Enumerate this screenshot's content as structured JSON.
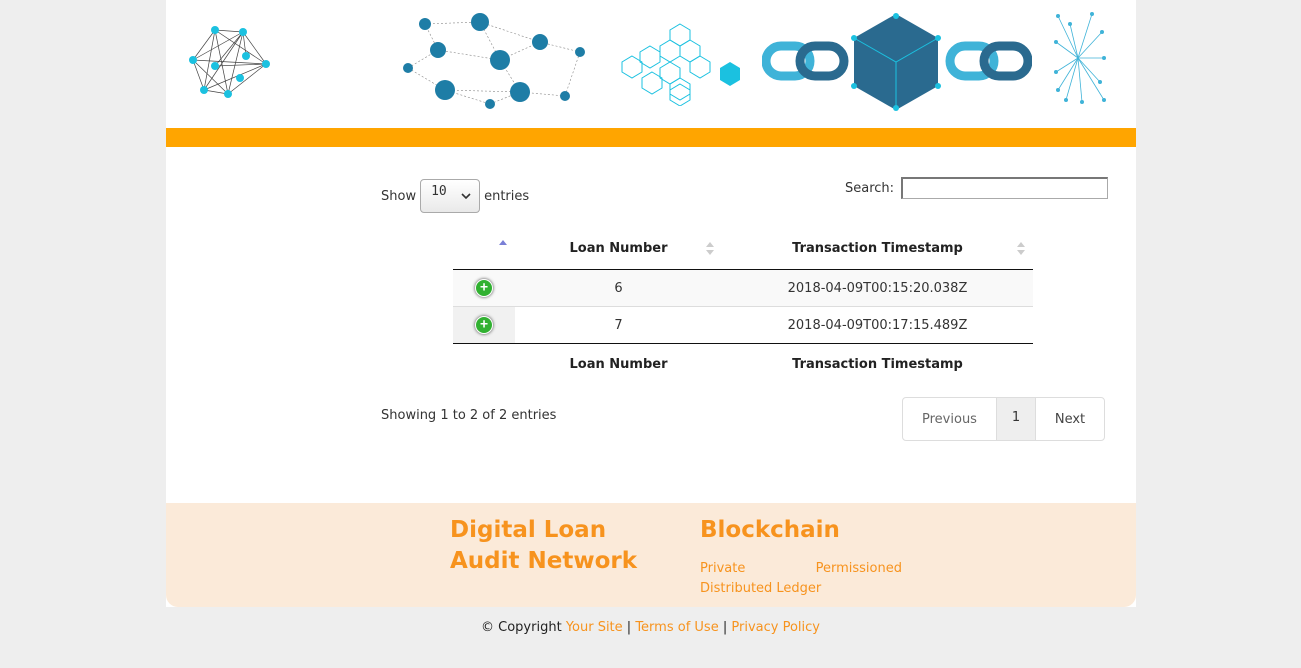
{
  "length_menu": {
    "show_label": "Show",
    "selected": "10",
    "entries_label": "entries"
  },
  "search": {
    "label": "Search:",
    "value": ""
  },
  "table": {
    "headers": [
      "",
      "Loan Number",
      "Transaction Timestamp"
    ],
    "rows": [
      {
        "loan_number": "6",
        "timestamp": "2018-04-09T00:15:20.038Z"
      },
      {
        "loan_number": "7",
        "timestamp": "2018-04-09T00:17:15.489Z"
      }
    ],
    "footers": [
      "",
      "Loan Number",
      "Transaction Timestamp"
    ]
  },
  "info": "Showing 1 to 2 of 2 entries",
  "pagination": {
    "previous": "Previous",
    "current": "1",
    "next": "Next"
  },
  "footer": {
    "brand": "Digital Loan Audit Network",
    "blockchain_title": "Blockchain",
    "blockchain_words": [
      "Private",
      "Permissioned",
      "Distributed Ledger"
    ]
  },
  "copyright": {
    "prefix": "© Copyright",
    "your_site": "Your Site",
    "sep": "|",
    "terms": "Terms of Use",
    "privacy": "Privacy Policy"
  },
  "colors": {
    "accent_orange": "#ffa500",
    "link_orange": "#f7931e",
    "footer_bg": "#fbead9",
    "cyan": "#1bc1e0",
    "dark_blue": "#2a6a8f"
  }
}
